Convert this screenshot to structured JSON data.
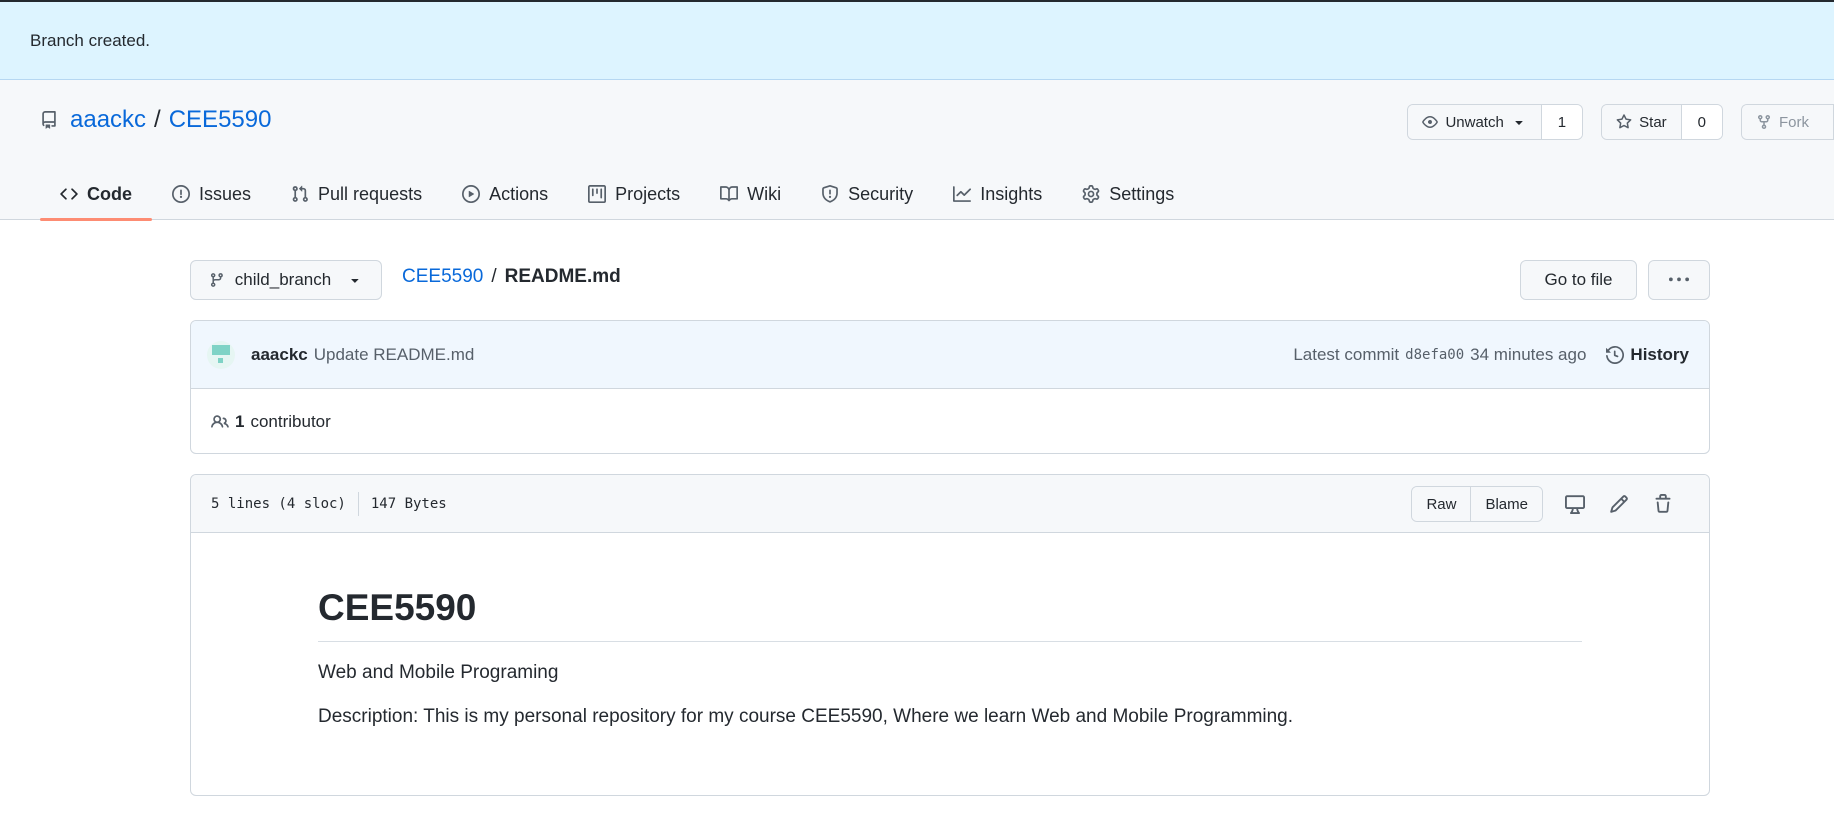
{
  "flash": {
    "message": "Branch created."
  },
  "repo": {
    "owner": "aaackc",
    "separator": "/",
    "name": "CEE5590"
  },
  "actions": {
    "watch_label": "Unwatch",
    "watch_count": "1",
    "star_label": "Star",
    "star_count": "0",
    "fork_label": "Fork"
  },
  "tabs": [
    {
      "label": "Code",
      "icon": "code-icon",
      "active": true
    },
    {
      "label": "Issues",
      "icon": "issue-icon"
    },
    {
      "label": "Pull requests",
      "icon": "pull-request-icon"
    },
    {
      "label": "Actions",
      "icon": "play-icon"
    },
    {
      "label": "Projects",
      "icon": "project-icon"
    },
    {
      "label": "Wiki",
      "icon": "book-icon"
    },
    {
      "label": "Security",
      "icon": "shield-icon"
    },
    {
      "label": "Insights",
      "icon": "graph-icon"
    },
    {
      "label": "Settings",
      "icon": "gear-icon"
    }
  ],
  "file_nav": {
    "branch": "child_branch",
    "crumb_repo": "CEE5590",
    "crumb_sep": "/",
    "crumb_file": "README.md",
    "goto_label": "Go to file",
    "more_label": "···"
  },
  "commit": {
    "author": "aaackc",
    "message": "Update README.md",
    "latest_label": "Latest commit",
    "sha": "d8efa00",
    "time": "34 minutes ago",
    "history_label": "History"
  },
  "contributors": {
    "count": "1",
    "label": "contributor"
  },
  "file": {
    "lines": "5 lines (4 sloc)",
    "size": "147 Bytes",
    "raw_label": "Raw",
    "blame_label": "Blame"
  },
  "readme": {
    "title": "CEE5590",
    "subtitle": "Web and Mobile Programing",
    "description": "Description: This is my personal repository for my course CEE5590, Where we learn Web and Mobile Programming."
  },
  "colors": {
    "accent": "#0969da",
    "active_tab_underline": "#fd8c73",
    "flash_bg": "#ddf4ff"
  }
}
